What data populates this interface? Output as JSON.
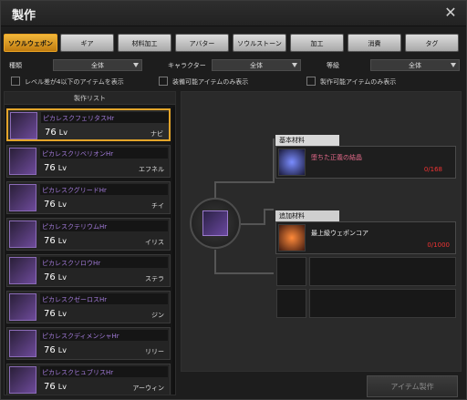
{
  "window": {
    "title": "製作",
    "close_glyph": "✕"
  },
  "tabs": [
    {
      "label": "ソウルウェポン",
      "active": true
    },
    {
      "label": "ギア",
      "active": false
    },
    {
      "label": "材料加工",
      "active": false
    },
    {
      "label": "アバター",
      "active": false
    },
    {
      "label": "ソウルストーン",
      "active": false
    },
    {
      "label": "加工",
      "active": false
    },
    {
      "label": "消費",
      "active": false
    },
    {
      "label": "タグ",
      "active": false
    }
  ],
  "filters": {
    "type_label": "種類",
    "type_value": "全体",
    "character_label": "キャラクター",
    "character_value": "全体",
    "grade_label": "等級",
    "grade_value": "全体"
  },
  "checkboxes": {
    "level_diff": "レベル差が4以下のアイテムを表示",
    "equippable": "装備可能アイテムのみ表示",
    "craftable": "製作可能アイテムのみ表示"
  },
  "list": {
    "header": "製作リスト",
    "items": [
      {
        "name": "ピカレスクフェリタスHr",
        "level": "76",
        "lv_label": "Lv",
        "character": "ナビ",
        "selected": true
      },
      {
        "name": "ピカレスクリベリオンHr",
        "level": "76",
        "lv_label": "Lv",
        "character": "エフネル",
        "selected": false
      },
      {
        "name": "ピカレスクグリードHr",
        "level": "76",
        "lv_label": "Lv",
        "character": "チイ",
        "selected": false
      },
      {
        "name": "ピカレスクテリウムHr",
        "level": "76",
        "lv_label": "Lv",
        "character": "イリス",
        "selected": false
      },
      {
        "name": "ピカレスクソロウHr",
        "level": "76",
        "lv_label": "Lv",
        "character": "ステラ",
        "selected": false
      },
      {
        "name": "ピカレスクゼーロスHr",
        "level": "76",
        "lv_label": "Lv",
        "character": "ジン",
        "selected": false
      },
      {
        "name": "ピカレスクディメンシャHr",
        "level": "76",
        "lv_label": "Lv",
        "character": "リリー",
        "selected": false
      },
      {
        "name": "ピカレスクヒュブリスHr",
        "level": "76",
        "lv_label": "Lv",
        "character": "アーウィン",
        "selected": false
      }
    ]
  },
  "detail": {
    "base_material_header": "基本材料",
    "base_material": {
      "name": "堕ちた正義の結晶",
      "count": "0/168"
    },
    "extra_material_header": "追加材料",
    "extra_material": {
      "name": "最上級ウェポンコア",
      "count": "0/1000"
    },
    "craft_button": "アイテム製作"
  },
  "colors": {
    "accent": "#e3a52a",
    "item_name": "#a27ad9",
    "count_red": "#e33"
  }
}
